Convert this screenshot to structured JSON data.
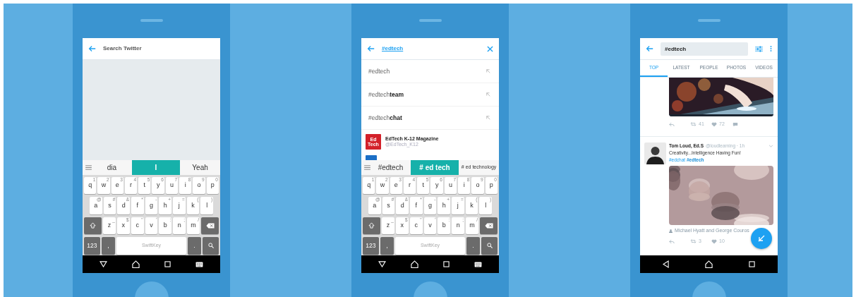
{
  "phones": [
    {
      "kind": "search_empty",
      "header": {
        "placeholder": "Search Twitter"
      },
      "keyboard": {
        "suggestions": [
          {
            "text": "dia",
            "selected": false
          },
          {
            "text": "I",
            "selected": true
          },
          {
            "text": "Yeah",
            "selected": false
          }
        ],
        "rows": [
          {
            "keys": [
              {
                "kind": "letter",
                "label": "q",
                "hint": "1"
              },
              {
                "kind": "letter",
                "label": "w",
                "hint": "2"
              },
              {
                "kind": "letter",
                "label": "e",
                "hint": "3"
              },
              {
                "kind": "letter",
                "label": "r",
                "hint": "4"
              },
              {
                "kind": "letter",
                "label": "t",
                "hint": "5"
              },
              {
                "kind": "letter",
                "label": "y",
                "hint": "6"
              },
              {
                "kind": "letter",
                "label": "u",
                "hint": "7"
              },
              {
                "kind": "letter",
                "label": "i",
                "hint": "8"
              },
              {
                "kind": "letter",
                "label": "o",
                "hint": "9"
              },
              {
                "kind": "letter",
                "label": "p",
                "hint": "0"
              }
            ]
          },
          {
            "keys": [
              {
                "kind": "letter",
                "label": "a",
                "hint": "@"
              },
              {
                "kind": "letter",
                "label": "s",
                "hint": "#"
              },
              {
                "kind": "letter",
                "label": "d",
                "hint": "&"
              },
              {
                "kind": "letter",
                "label": "f",
                "hint": "*"
              },
              {
                "kind": "letter",
                "label": "g",
                "hint": "-"
              },
              {
                "kind": "letter",
                "label": "h",
                "hint": "+"
              },
              {
                "kind": "letter",
                "label": "j",
                "hint": "="
              },
              {
                "kind": "letter",
                "label": "k",
                "hint": "("
              },
              {
                "kind": "letter",
                "label": "l",
                "hint": ")"
              }
            ]
          },
          {
            "keys": [
              {
                "kind": "shift"
              },
              {
                "kind": "letter",
                "label": "z",
                "hint": "_"
              },
              {
                "kind": "letter",
                "label": "x",
                "hint": "$"
              },
              {
                "kind": "letter",
                "label": "c",
                "hint": "\""
              },
              {
                "kind": "letter",
                "label": "v",
                "hint": "'"
              },
              {
                "kind": "letter",
                "label": "b",
                "hint": ":"
              },
              {
                "kind": "letter",
                "label": "n",
                "hint": ";"
              },
              {
                "kind": "letter",
                "label": "m",
                "hint": "/"
              },
              {
                "kind": "backspace"
              }
            ]
          },
          {
            "keys": [
              {
                "kind": "mode",
                "label": "123"
              },
              {
                "kind": "symbol",
                "label": ","
              },
              {
                "kind": "space",
                "label": "SwiftKey"
              },
              {
                "kind": "symbol",
                "label": "."
              },
              {
                "kind": "search"
              }
            ]
          }
        ]
      },
      "nav": {
        "keyboard_open": true
      }
    },
    {
      "kind": "typeahead",
      "header": {
        "query": "#edtech"
      },
      "suggestions": [
        {
          "text": "#edtech"
        },
        {
          "text": "#edtech**team**"
        },
        {
          "text": "#edtech**chat**"
        }
      ],
      "accounts": [
        {
          "name": "EdTech K-12 Magazine",
          "handle": "@EdTech_K12",
          "logo_text": "Ed Tech"
        }
      ],
      "keyboard": {
        "suggestions": [
          {
            "text": "#edtech",
            "selected": false
          },
          {
            "text": "# ed tech",
            "selected": true
          },
          {
            "text": "# ed technology",
            "selected": false
          }
        ],
        "rows": [
          {
            "keys": [
              {
                "kind": "letter",
                "label": "q",
                "hint": "1"
              },
              {
                "kind": "letter",
                "label": "w",
                "hint": "2"
              },
              {
                "kind": "letter",
                "label": "e",
                "hint": "3"
              },
              {
                "kind": "letter",
                "label": "r",
                "hint": "4"
              },
              {
                "kind": "letter",
                "label": "t",
                "hint": "5"
              },
              {
                "kind": "letter",
                "label": "y",
                "hint": "6"
              },
              {
                "kind": "letter",
                "label": "u",
                "hint": "7"
              },
              {
                "kind": "letter",
                "label": "i",
                "hint": "8"
              },
              {
                "kind": "letter",
                "label": "o",
                "hint": "9"
              },
              {
                "kind": "letter",
                "label": "p",
                "hint": "0"
              }
            ]
          },
          {
            "keys": [
              {
                "kind": "letter",
                "label": "a",
                "hint": "@"
              },
              {
                "kind": "letter",
                "label": "s",
                "hint": "#"
              },
              {
                "kind": "letter",
                "label": "d",
                "hint": "&"
              },
              {
                "kind": "letter",
                "label": "f",
                "hint": "*"
              },
              {
                "kind": "letter",
                "label": "g",
                "hint": "-"
              },
              {
                "kind": "letter",
                "label": "h",
                "hint": "+"
              },
              {
                "kind": "letter",
                "label": "j",
                "hint": "="
              },
              {
                "kind": "letter",
                "label": "k",
                "hint": "("
              },
              {
                "kind": "letter",
                "label": "l",
                "hint": ")"
              }
            ]
          },
          {
            "keys": [
              {
                "kind": "shift"
              },
              {
                "kind": "letter",
                "label": "z",
                "hint": "_"
              },
              {
                "kind": "letter",
                "label": "x",
                "hint": "$"
              },
              {
                "kind": "letter",
                "label": "c",
                "hint": "\""
              },
              {
                "kind": "letter",
                "label": "v",
                "hint": "'"
              },
              {
                "kind": "letter",
                "label": "b",
                "hint": ":"
              },
              {
                "kind": "letter",
                "label": "n",
                "hint": ";"
              },
              {
                "kind": "letter",
                "label": "m",
                "hint": "/"
              },
              {
                "kind": "backspace"
              }
            ]
          },
          {
            "keys": [
              {
                "kind": "mode",
                "label": "123"
              },
              {
                "kind": "symbol",
                "label": ","
              },
              {
                "kind": "space",
                "label": "SwiftKey"
              },
              {
                "kind": "symbol",
                "label": "."
              },
              {
                "kind": "search"
              }
            ]
          }
        ]
      },
      "nav": {
        "keyboard_open": true
      }
    },
    {
      "kind": "results",
      "header": {
        "query": "#edtech"
      },
      "tabs": [
        {
          "label": "TOP",
          "selected": true
        },
        {
          "label": "LATEST",
          "selected": false
        },
        {
          "label": "PEOPLE",
          "selected": false
        },
        {
          "label": "PHOTOS",
          "selected": false
        },
        {
          "label": "VIDEOS",
          "selected": false
        }
      ],
      "tweets": [
        {
          "kind": "media_tail",
          "retweets": "41",
          "likes": "72"
        },
        {
          "kind": "full",
          "author": "Tom Loud, Ed.S",
          "handle": "@loudlearning · 1h",
          "text": "Creativity...Intelligence Having Fun!",
          "hashtags": "#edchat **#edtech**",
          "tagged": "Michael Hyatt and George Couros",
          "retweets": "3",
          "likes": "10"
        }
      ],
      "nav": {
        "keyboard_open": false
      }
    }
  ]
}
